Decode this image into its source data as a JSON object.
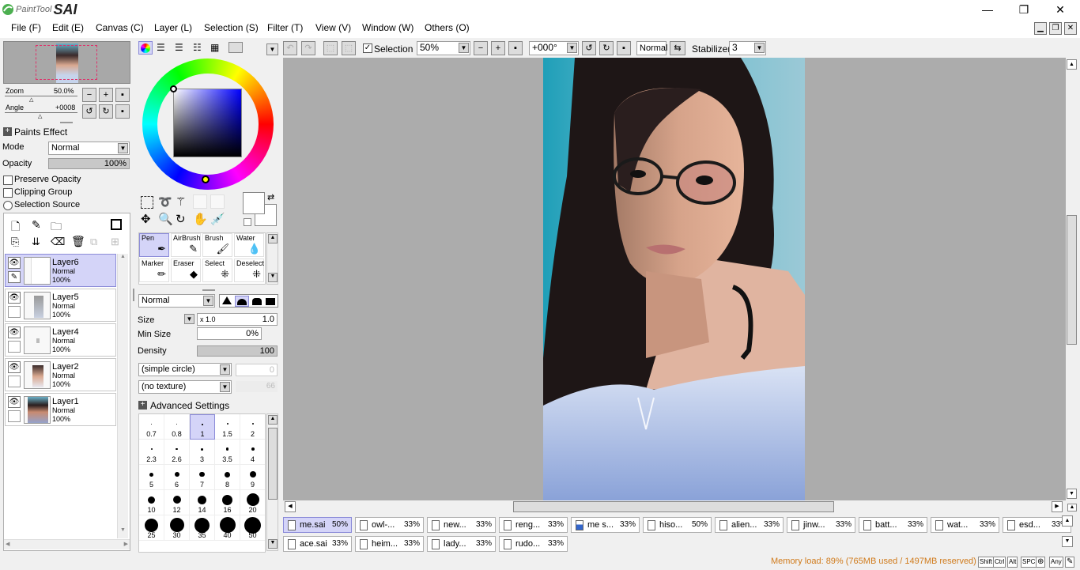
{
  "app": {
    "logo_small": "PaintTool",
    "logo_big": "SAI"
  },
  "window_controls": {
    "minimize": "—",
    "maximize": "❐",
    "close": "✕"
  },
  "menu": [
    "File (F)",
    "Edit (E)",
    "Canvas (C)",
    "Layer (L)",
    "Selection (S)",
    "Filter (T)",
    "View (V)",
    "Window (W)",
    "Others (O)"
  ],
  "navigator": {
    "zoom_label": "Zoom",
    "zoom_value": "50.0%",
    "angle_label": "Angle",
    "angle_value": "+0008"
  },
  "layer_props": {
    "paints_effect": "Paints Effect",
    "mode_label": "Mode",
    "mode_value": "Normal",
    "opacity_label": "Opacity",
    "opacity_value": "100%",
    "preserve_opacity": "Preserve Opacity",
    "clipping_group": "Clipping Group",
    "selection_source": "Selection Source"
  },
  "layers": [
    {
      "name": "Layer6",
      "mode": "Normal",
      "opacity": "100%"
    },
    {
      "name": "Layer5",
      "mode": "Normal",
      "opacity": "100%"
    },
    {
      "name": "Layer4",
      "mode": "Normal",
      "opacity": "100%"
    },
    {
      "name": "Layer2",
      "mode": "Normal",
      "opacity": "100%"
    },
    {
      "name": "Layer1",
      "mode": "Normal",
      "opacity": "100%"
    }
  ],
  "tools": [
    "Pen",
    "AirBrush",
    "Brush",
    "Water",
    "Marker",
    "Eraser",
    "Select",
    "Deselect"
  ],
  "brush_settings": {
    "blend_mode": "Normal",
    "size_label": "Size",
    "size_mult": "x 1.0",
    "size_value": "1.0",
    "min_size_label": "Min Size",
    "min_size_value": "0%",
    "density_label": "Density",
    "density_value": "100",
    "shape": "(simple circle)",
    "shape_value": "0",
    "texture": "(no texture)",
    "texture_value": "66",
    "advanced": "Advanced Settings"
  },
  "brush_sizes": [
    "0.7",
    "0.8",
    "1",
    "1.5",
    "2",
    "2.3",
    "2.6",
    "3",
    "3.5",
    "4",
    "5",
    "6",
    "7",
    "8",
    "9",
    "10",
    "12",
    "14",
    "16",
    "20",
    "25",
    "30",
    "35",
    "40",
    "50"
  ],
  "toolbar": {
    "selection_label": "Selection",
    "zoom_value": "50%",
    "angle_value": "+000°",
    "mode_value": "Normal",
    "stabilizer_label": "Stabilizer",
    "stabilizer_value": "3"
  },
  "tabs": [
    {
      "name": "me.sai",
      "pct": "50%"
    },
    {
      "name": "owl-...",
      "pct": "33%"
    },
    {
      "name": "new...",
      "pct": "33%"
    },
    {
      "name": "reng...",
      "pct": "33%"
    },
    {
      "name": "me s...",
      "pct": "33%"
    },
    {
      "name": "hiso...",
      "pct": "50%"
    },
    {
      "name": "alien...",
      "pct": "33%"
    },
    {
      "name": "jinw...",
      "pct": "33%"
    },
    {
      "name": "batt...",
      "pct": "33%"
    },
    {
      "name": "wat...",
      "pct": "33%"
    },
    {
      "name": "esd...",
      "pct": "33%"
    },
    {
      "name": "ace.sai",
      "pct": "33%"
    },
    {
      "name": "heim...",
      "pct": "33%"
    },
    {
      "name": "lady...",
      "pct": "33%"
    },
    {
      "name": "rudo...",
      "pct": "33%"
    }
  ],
  "status": {
    "memory": "Memory load: 89% (765MB used / 1497MB reserved)",
    "keys": [
      "Shift",
      "Ctrl",
      "Alt",
      "SPC",
      "⊕",
      "Any",
      "✎"
    ]
  },
  "colors": {
    "accent": "#d4d4f8",
    "canvas_bg": "#acacac",
    "memory_text": "#d07a1a",
    "sky": "#94c4d4"
  }
}
